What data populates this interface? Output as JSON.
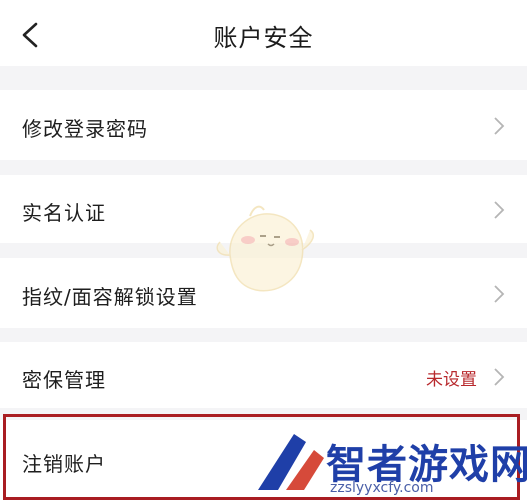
{
  "header": {
    "title": "账户安全",
    "back_icon": "chevron-left-icon"
  },
  "rows": [
    {
      "label": "修改登录密码",
      "value": "",
      "chevron": true
    },
    {
      "label": "实名认证",
      "value": "",
      "chevron": true
    },
    {
      "label": "指纹/面容解锁设置",
      "value": "",
      "chevron": true
    },
    {
      "label": "密保管理",
      "value": "未设置",
      "chevron": true
    },
    {
      "label": "注销账户",
      "value": "",
      "chevron": false,
      "highlighted": true
    }
  ],
  "colors": {
    "background": "#f4f4f6",
    "row_background": "#ffffff",
    "accent_value": "#b8292d",
    "highlight_border": "#a91d22",
    "watermark_text": "#1f3fa8"
  },
  "watermark": {
    "text": "智者游戏网",
    "url": "zzslyyxcfy.com"
  }
}
